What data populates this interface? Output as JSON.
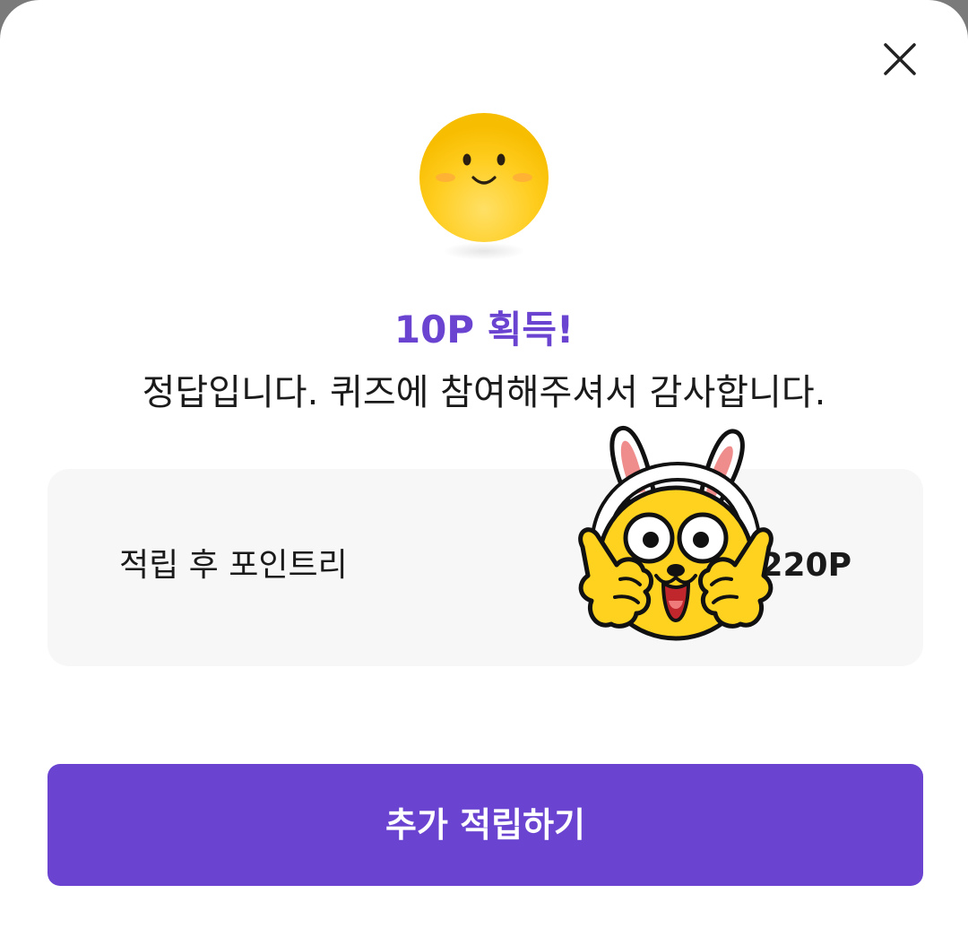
{
  "dialog": {
    "close_icon": "close-icon",
    "reward_icon": "smiley-face-icon",
    "title": "10P 획득!",
    "message": "정답입니다. 퀴즈에 참여해주셔서 감사합니다.",
    "points_label": "적립 후 포인트리",
    "points_value": ",220P",
    "sticker": "rabbit-ears-character-sticker",
    "cta_label": "추가 적립하기"
  },
  "colors": {
    "accent": "#6a44d1",
    "emoji_yellow": "#ffc928",
    "box_background": "#f7f7f7"
  }
}
